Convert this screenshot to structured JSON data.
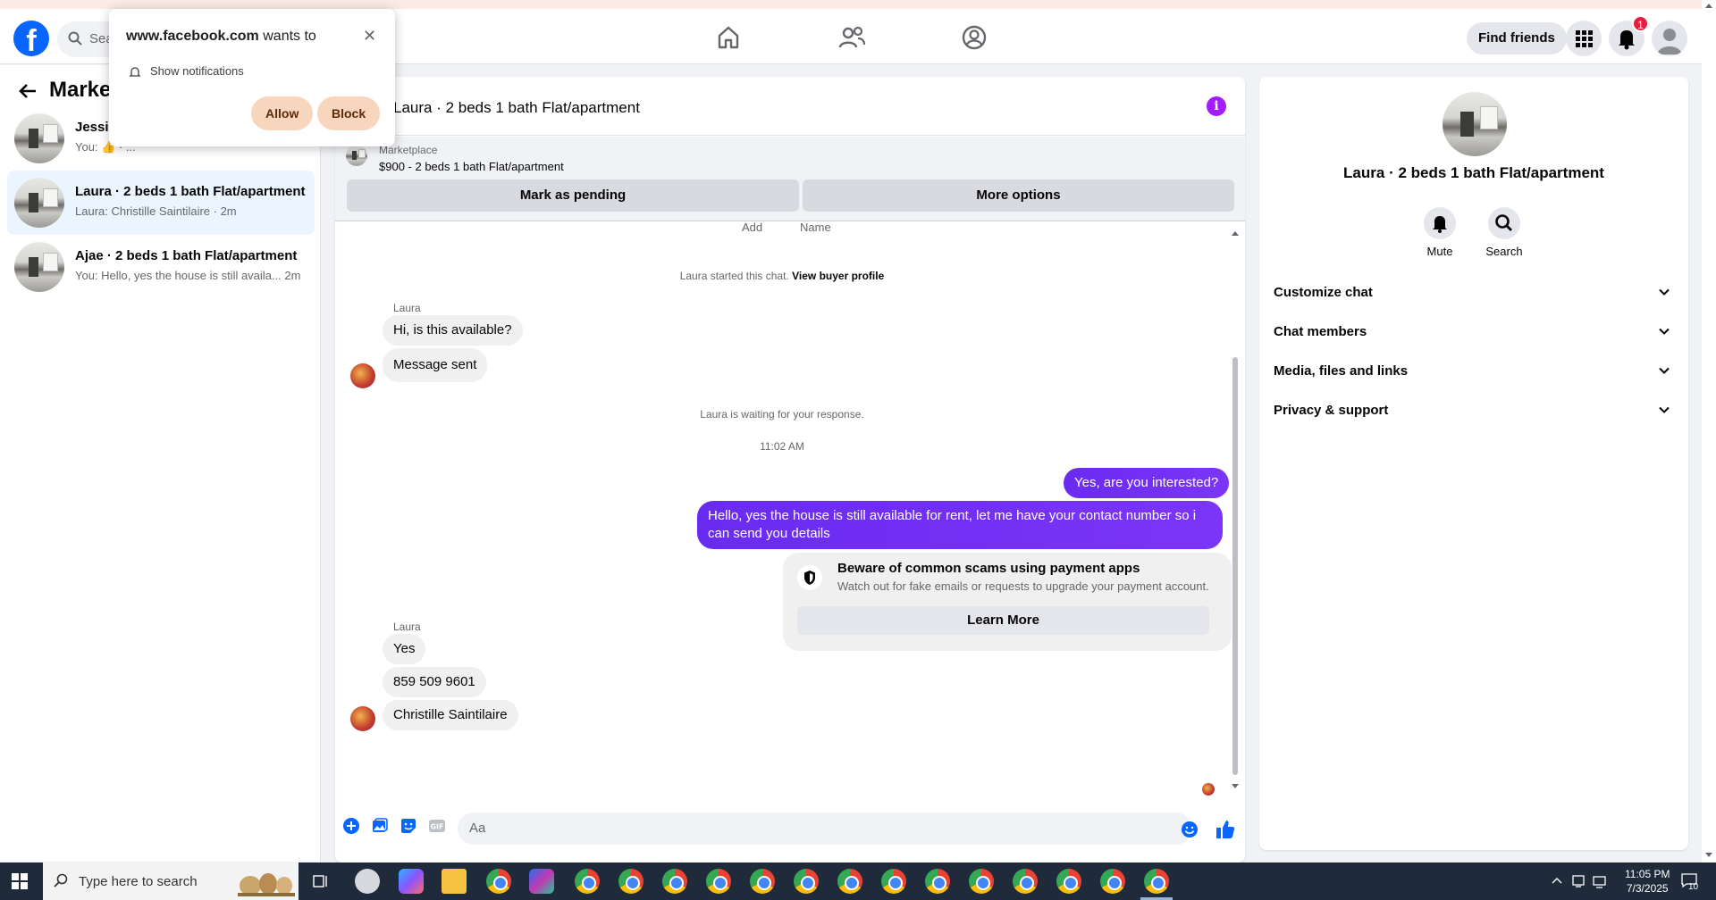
{
  "popup": {
    "site": "www.facebook.com",
    "wants_to": "wants to",
    "permission": "Show notifications",
    "allow": "Allow",
    "block": "Block",
    "close": "✕"
  },
  "header": {
    "logo": "f",
    "search_placeholder": "Sea",
    "find_friends": "Find friends",
    "notification_count": "1"
  },
  "sidebar": {
    "title": "Marke",
    "conversations": [
      {
        "name": "Jessic",
        "snippet": "You: 👍 · ..."
      },
      {
        "name": "Laura · 2 beds 1 bath Flat/apartment",
        "snippet": "Laura: Christille Saintilaire · 2m"
      },
      {
        "name": "Ajae · 2 beds 1 bath Flat/apartment",
        "snippet": "You: Hello, yes the house is still availa...  2m"
      }
    ]
  },
  "chat": {
    "title": "Laura · 2 beds 1 bath Flat/apartment",
    "listing_source": "Marketplace",
    "listing_price": "$900 - 2 beds 1 bath Flat/apartment",
    "mark_pending": "Mark as pending",
    "more_options": "More options",
    "cut_add": "Add",
    "cut_name": "Name",
    "started_text": "Laura started this chat.",
    "view_buyer": "View buyer profile",
    "sender1": "Laura",
    "msg1": "Hi, is this available?",
    "msg2": "Message sent",
    "waiting": "Laura is waiting for your response.",
    "time": "11:02 AM",
    "out1": "Yes, are you interested?",
    "out2": "Hello, yes the house is still available for rent, let me have your contact number so i can send you details",
    "scam_title": "Beware of common scams using payment apps",
    "scam_sub": "Watch out for fake emails or requests to upgrade your payment account.",
    "learn_more": "Learn More",
    "sender2": "Laura",
    "msg3": "Yes",
    "msg4": "859 509 9601",
    "msg5": "Christille Saintilaire",
    "composer_placeholder": "Aa"
  },
  "right_panel": {
    "title": "Laura · 2 beds 1 bath Flat/apartment",
    "mute": "Mute",
    "search": "Search",
    "sections": [
      "Customize chat",
      "Chat members",
      "Media, files and links",
      "Privacy & support"
    ]
  },
  "taskbar": {
    "search_placeholder": "Type here to search",
    "time": "11:05 PM",
    "date": "7/3/2025",
    "notif_count": "10"
  },
  "colors": {
    "fb_blue": "#0866ff",
    "outgoing_bubble": "#7b2ff7",
    "info_purple": "#a41bfe",
    "popup_button": "#f8d6bd"
  }
}
